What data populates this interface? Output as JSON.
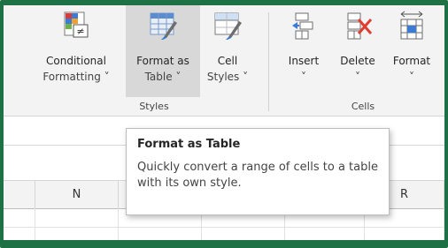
{
  "colors": {
    "accent": "#1e7145",
    "ribbon_bg": "#f3f3f3",
    "hover_bg": "#d8d8d8",
    "delete_x": "#e03c31"
  },
  "styles_group": {
    "label": "Styles",
    "buttons": [
      {
        "line1": "Conditional",
        "line2": "Formatting ˅",
        "icon": "conditional-formatting-icon"
      },
      {
        "line1": "Format as",
        "line2": "Table ˅",
        "icon": "format-as-table-icon"
      },
      {
        "line1": "Cell",
        "line2": "Styles ˅",
        "icon": "cell-styles-icon"
      }
    ]
  },
  "cells_group": {
    "label": "Cells",
    "buttons": [
      {
        "line1": "Insert",
        "line2": "˅",
        "icon": "insert-cells-icon"
      },
      {
        "line1": "Delete",
        "line2": "˅",
        "icon": "delete-cells-icon"
      },
      {
        "line1": "Format",
        "line2": "˅",
        "icon": "format-cells-icon"
      }
    ]
  },
  "tooltip": {
    "title": "Format as Table",
    "body": "Quickly convert a range of cells to a table with its own style."
  },
  "columns": [
    "N",
    "R"
  ]
}
